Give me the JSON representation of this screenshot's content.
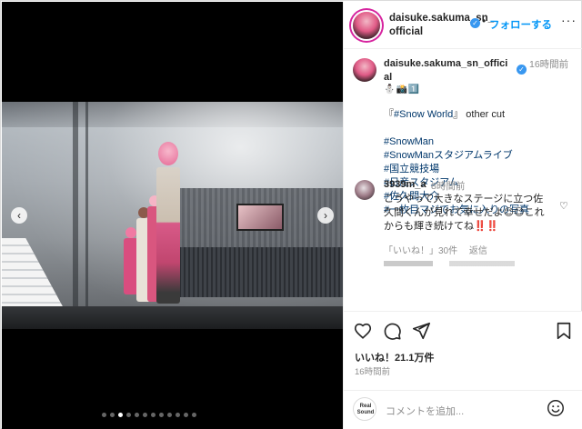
{
  "post": {
    "author": "daisuke.sakuma_sn_official",
    "follow_label": "フォローする",
    "more_label": "···",
    "verified_mark": "✓"
  },
  "media": {
    "prev_icon": "‹",
    "next_icon": "›",
    "slide_count": 12,
    "active_slide_index": 2
  },
  "caption": {
    "author": "daisuke.sakuma_sn_official",
    "time": "16時間前",
    "emoji_line": "⛄📸1️⃣",
    "lines": [
      {
        "text": "『#Snow World』 other cut",
        "type": "mixed"
      },
      {
        "text": "",
        "type": "blank"
      },
      {
        "text": "#SnowMan",
        "type": "hashtag"
      },
      {
        "text": "#SnowManスタジアムライブ",
        "type": "hashtag"
      },
      {
        "text": "#国立競技場",
        "type": "hashtag"
      },
      {
        "text": "#日産スタジアム",
        "type": "hashtag"
      },
      {
        "text": "#佐久間大介",
        "type": "hashtag"
      },
      {
        "text": "#一枚目マジでお気に入りの写真",
        "type": "hashtag"
      }
    ],
    "first_line_prefix": "『",
    "first_line_hashtag": "#Snow World",
    "first_line_suffix": "』 other cut"
  },
  "comment": {
    "user": "3939m_a",
    "time": "8時間前",
    "text": "こうやって大きなステージに立つ佐久間くんが見れて幸せだよ😊😊これからも輝き続けてね‼️‼️",
    "likes_label": "「いいね！」30件",
    "reply_label": "返信",
    "heart_icon": "♡"
  },
  "actions": {
    "likes": "いいね！21.1万件",
    "time": "16時間前"
  },
  "composer": {
    "avatar_text": "Real Sound",
    "placeholder": "コメントを追加..."
  },
  "colors": {
    "link_blue": "#0095f6",
    "hashtag": "#00376b",
    "muted": "#8e8e8e",
    "verified": "#3897f0"
  }
}
